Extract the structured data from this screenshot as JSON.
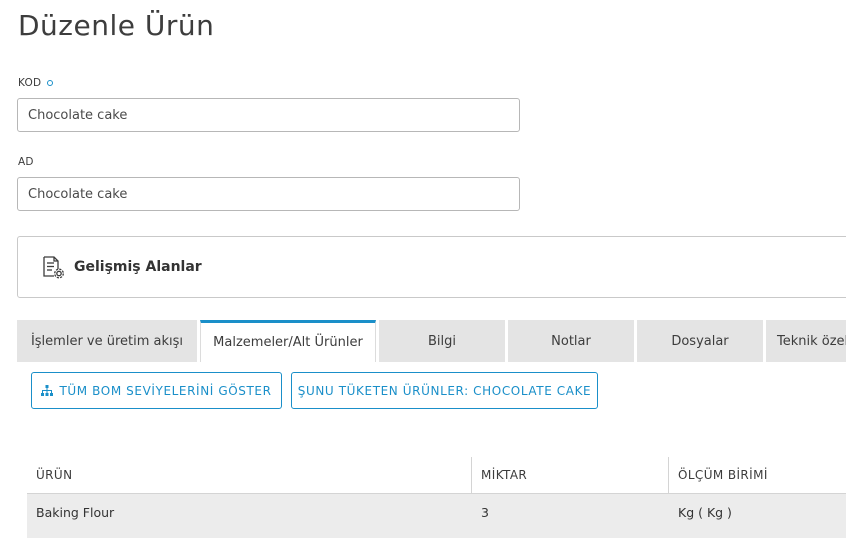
{
  "page": {
    "title": "Düzenle Ürün"
  },
  "form": {
    "code": {
      "label": "KOD",
      "value": "Chocolate cake"
    },
    "name": {
      "label": "AD",
      "value": "Chocolate cake"
    }
  },
  "advanced": {
    "label": "Gelişmiş Alanlar",
    "icon": "settings-document-icon"
  },
  "tabs": [
    {
      "label": "İşlemler ve üretim akışı"
    },
    {
      "label": "Malzemeler/Alt Ürünler",
      "active": true
    },
    {
      "label": "Bilgi"
    },
    {
      "label": "Notlar"
    },
    {
      "label": "Dosyalar"
    },
    {
      "label": "Teknik özellikler"
    }
  ],
  "buttons": {
    "show_bom": {
      "label": "TÜM BOM SEVİYELERİNİ GÖSTER",
      "icon": "hierarchy-icon"
    },
    "consuming": {
      "label": "ŞUNU TÜKETEN ÜRÜNLER: CHOCOLATE CAKE"
    }
  },
  "table": {
    "headers": [
      "ÜRÜN",
      "MİKTAR",
      "ÖLÇÜM BİRİMİ"
    ],
    "rows": [
      [
        "Baking Flour",
        "3",
        "Kg ( Kg )"
      ]
    ]
  },
  "colors": {
    "accent": "#1a8fc9",
    "tab_bg": "#e4e4e4",
    "row_bg": "#ececec"
  }
}
